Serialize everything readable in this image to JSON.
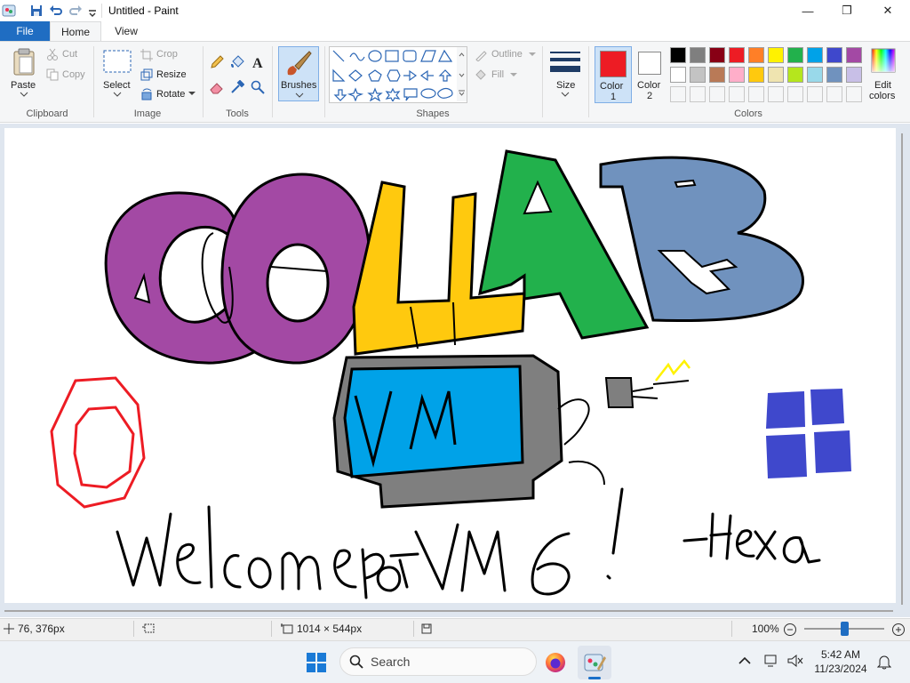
{
  "window": {
    "title": "Untitled - Paint",
    "controls": {
      "minimize": "—",
      "maximize": "❐",
      "close": "✕"
    }
  },
  "menu": {
    "file": "File",
    "tabs": [
      {
        "label": "Home"
      },
      {
        "label": "View"
      }
    ]
  },
  "ribbon": {
    "clipboard": {
      "paste": "Paste",
      "cut": "Cut",
      "copy": "Copy",
      "group": "Clipboard"
    },
    "image": {
      "select": "Select",
      "crop": "Crop",
      "resize": "Resize",
      "rotate": "Rotate",
      "group": "Image"
    },
    "tools": {
      "group": "Tools"
    },
    "brushes": {
      "label": "Brushes"
    },
    "shapes": {
      "outline": "Outline",
      "fill": "Fill",
      "group": "Shapes"
    },
    "size": {
      "label": "Size"
    },
    "color1": {
      "label": "Color",
      "num": "1",
      "value": "#ed1c24"
    },
    "color2": {
      "label": "Color",
      "num": "2",
      "value": "#ffffff"
    },
    "colors": {
      "group": "Colors",
      "edit_line1": "Edit",
      "edit_line2": "colors",
      "row1": [
        "#000000",
        "#7f7f7f",
        "#880015",
        "#ed1c24",
        "#ff7f27",
        "#fff200",
        "#22b14c",
        "#00a2e8",
        "#3f48cc",
        "#a349a4"
      ],
      "row2": [
        "#ffffff",
        "#c3c3c3",
        "#b97a57",
        "#ffaec9",
        "#ffc90e",
        "#efe4b0",
        "#b5e61d",
        "#99d9ea",
        "#7092be",
        "#c8bfe7"
      ]
    }
  },
  "canvas": {
    "drawing_text": "Welcome to VM 6! -Hexa",
    "colors": {
      "purple": "#a349a4",
      "yellow": "#ffc90e",
      "green": "#22b14c",
      "steel_blue": "#7092be",
      "screen_blue": "#00a2e8",
      "gray": "#7f7f7f",
      "red": "#ed1c24",
      "windows_blue": "#3f48cc",
      "doodle_yellow": "#fff200"
    }
  },
  "statusbar": {
    "cursor_pos": "76, 376px",
    "canvas_size": "1014 × 544px",
    "zoom": "100%"
  },
  "taskbar": {
    "search_placeholder": "Search",
    "time": "5:42 AM",
    "date": "11/23/2024"
  }
}
